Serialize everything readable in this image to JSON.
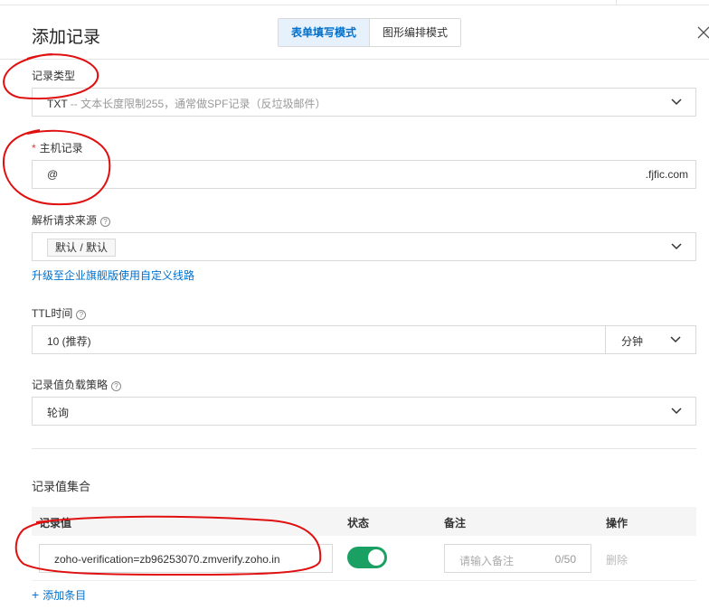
{
  "dialog": {
    "title": "添加记录",
    "tabs": [
      {
        "label": "表单填写模式",
        "active": true
      },
      {
        "label": "图形编排模式",
        "active": false
      }
    ]
  },
  "record_type": {
    "label": "记录类型",
    "value": "TXT",
    "hint": " -- 文本长度限制255，通常做SPF记录（反垃圾邮件）"
  },
  "host": {
    "required_mark": "*",
    "label": "主机记录",
    "value": "@",
    "suffix": ".fjfic.com"
  },
  "line": {
    "label": "解析请求来源",
    "tag": "默认 / 默认",
    "upgrade_link": "升级至企业旗舰版使用自定义线路"
  },
  "ttl": {
    "label": "TTL时间",
    "value": "10 (推荐)",
    "unit": "分钟"
  },
  "strategy": {
    "label": "记录值负载策略",
    "value": "轮询"
  },
  "records": {
    "title": "记录值集合",
    "headers": {
      "value": "记录值",
      "status": "状态",
      "note": "备注",
      "action": "操作"
    },
    "rows": [
      {
        "value": "zoho-verification=zb96253070.zmverify.zoho.in",
        "enabled": true,
        "note_placeholder": "请输入备注",
        "note_count": "0/50",
        "action": "删除"
      }
    ],
    "add_label": "添加条目"
  },
  "help_glyph": "?",
  "colors": {
    "accent": "#0070cc",
    "toggle_on": "#1aa062",
    "annotation": "#e01010"
  }
}
